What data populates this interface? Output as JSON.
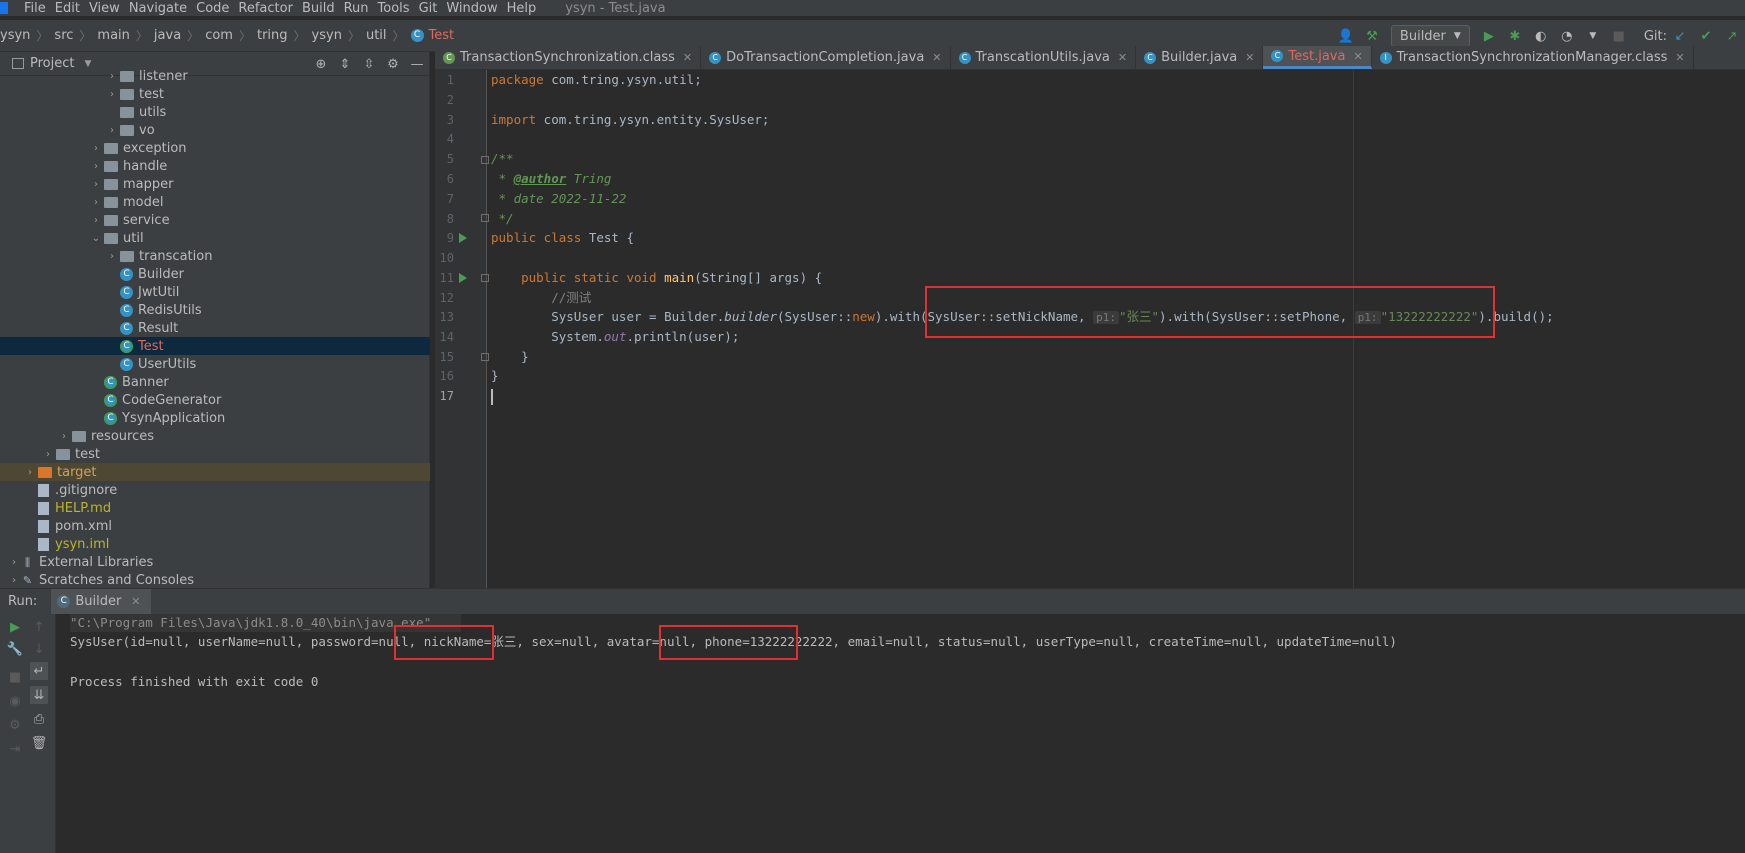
{
  "menu": {
    "items": [
      "File",
      "Edit",
      "View",
      "Navigate",
      "Code",
      "Refactor",
      "Build",
      "Run",
      "Tools",
      "Git",
      "Window",
      "Help"
    ],
    "window_title": "ysyn - Test.java"
  },
  "breadcrumb": [
    "ysyn",
    "src",
    "main",
    "java",
    "com",
    "tring",
    "ysyn",
    "util",
    "Test"
  ],
  "toolbar": {
    "run_config": "Builder",
    "git_label": "Git:"
  },
  "project": {
    "title": "Project",
    "tree": [
      {
        "label": "listener",
        "kind": "folder",
        "indent": 2,
        "arrow": "›"
      },
      {
        "label": "test",
        "kind": "folder",
        "indent": 2,
        "arrow": "›"
      },
      {
        "label": "utils",
        "kind": "folder",
        "indent": 2,
        "arrow": ""
      },
      {
        "label": "vo",
        "kind": "folder",
        "indent": 2,
        "arrow": "›"
      },
      {
        "label": "exception",
        "kind": "folder",
        "indent": 1,
        "arrow": "›"
      },
      {
        "label": "handle",
        "kind": "folder",
        "indent": 1,
        "arrow": "›"
      },
      {
        "label": "mapper",
        "kind": "folder",
        "indent": 1,
        "arrow": "›"
      },
      {
        "label": "model",
        "kind": "folder",
        "indent": 1,
        "arrow": "›"
      },
      {
        "label": "service",
        "kind": "folder",
        "indent": 1,
        "arrow": "›"
      },
      {
        "label": "util",
        "kind": "folder",
        "indent": 1,
        "arrow": "⌄"
      },
      {
        "label": "transcation",
        "kind": "folder",
        "indent": 2,
        "arrow": "›"
      },
      {
        "label": "Builder",
        "kind": "class",
        "indent": 2,
        "arrow": ""
      },
      {
        "label": "JwtUtil",
        "kind": "class",
        "indent": 2,
        "arrow": ""
      },
      {
        "label": "RedisUtils",
        "kind": "class",
        "indent": 2,
        "arrow": ""
      },
      {
        "label": "Result",
        "kind": "class",
        "indent": 2,
        "arrow": ""
      },
      {
        "label": "Test",
        "kind": "main",
        "indent": 2,
        "arrow": "",
        "selected": true
      },
      {
        "label": "UserUtils",
        "kind": "class",
        "indent": 2,
        "arrow": ""
      },
      {
        "label": "Banner",
        "kind": "main",
        "indent": 1,
        "arrow": ""
      },
      {
        "label": "CodeGenerator",
        "kind": "main",
        "indent": 1,
        "arrow": ""
      },
      {
        "label": "YsynApplication",
        "kind": "main",
        "indent": 1,
        "arrow": ""
      },
      {
        "label": "resources",
        "kind": "folder",
        "indent": -1,
        "arrow": "›"
      },
      {
        "label": "test",
        "kind": "folder",
        "indent": -2,
        "arrow": "›"
      },
      {
        "label": "target",
        "kind": "orange-folder",
        "indent": -4,
        "arrow": "›",
        "excluded": true
      },
      {
        "label": ".gitignore",
        "kind": "file",
        "indent": -3,
        "arrow": ""
      },
      {
        "label": "HELP.md",
        "kind": "file",
        "indent": -3,
        "arrow": "",
        "olive": true
      },
      {
        "label": "pom.xml",
        "kind": "file",
        "indent": -3,
        "arrow": ""
      },
      {
        "label": "ysyn.iml",
        "kind": "file",
        "indent": -3,
        "arrow": "",
        "olive": true
      },
      {
        "label": "External Libraries",
        "kind": "lib",
        "indent": -5,
        "arrow": "›"
      },
      {
        "label": "Scratches and Consoles",
        "kind": "lib",
        "indent": -5,
        "arrow": "›"
      }
    ]
  },
  "editor": {
    "tabs": [
      {
        "label": "TransactionSynchronization.class",
        "icon": "green"
      },
      {
        "label": "DoTransactionCompletion.java",
        "icon": "class"
      },
      {
        "label": "TranscationUtils.java",
        "icon": "class"
      },
      {
        "label": "Builder.java",
        "icon": "class"
      },
      {
        "label": "Test.java",
        "icon": "main",
        "active": true
      },
      {
        "label": "TransactionSynchronizationManager.class",
        "icon": "interface"
      }
    ],
    "line_numbers": [
      "1",
      "2",
      "3",
      "4",
      "5",
      "6",
      "7",
      "8",
      "9",
      "10",
      "11",
      "12",
      "13",
      "14",
      "15",
      "16",
      "17"
    ],
    "code": {
      "l1_kw": "package",
      "l1_rest": " com.tring.ysyn.util;",
      "l3_kw": "import",
      "l3_rest": " com.tring.ysyn.entity.SysUser;",
      "l5": "/**",
      "l6_pre": " * ",
      "l6_tag": "@author",
      "l6_val": " Tring",
      "l7": " * date 2022-11-22",
      "l8": " */",
      "l9_kw": "public class",
      "l9_rest": " Test {",
      "l11_kw": "    public static void",
      "l11_fn": " main",
      "l11_rest": "(String[] args) {",
      "l12": "        //测试",
      "l13_a": "        SysUser user = Builder.",
      "l13_b": "builder",
      "l13_c": "(SysUser::",
      "l13_d": "new",
      "l13_e": ").with(SysUser::setNickName, ",
      "l13_hint1": "p1:",
      "l13_s1": "\"张三\"",
      "l13_f": ").with(SysUser::setPhone, ",
      "l13_hint2": "p1:",
      "l13_s2": "\"13222222222\"",
      "l13_g": ").build();",
      "l14_a": "        System.",
      "l14_b": "out",
      "l14_c": ".println(user);",
      "l15": "    }",
      "l16": "}"
    }
  },
  "run": {
    "label": "Run:",
    "tab": "Builder",
    "console": {
      "cmd": "\"C:\\Program Files\\Java\\jdk1.8.0_40\\bin\\java.exe\" ...",
      "output": "SysUser(id=null, userName=null, password=null, nickName=张三, sex=null, avatar=null, phone=13222222222, email=null, status=null, userType=null, createTime=null, updateTime=null)",
      "exit": "Process finished with exit code 0"
    }
  }
}
